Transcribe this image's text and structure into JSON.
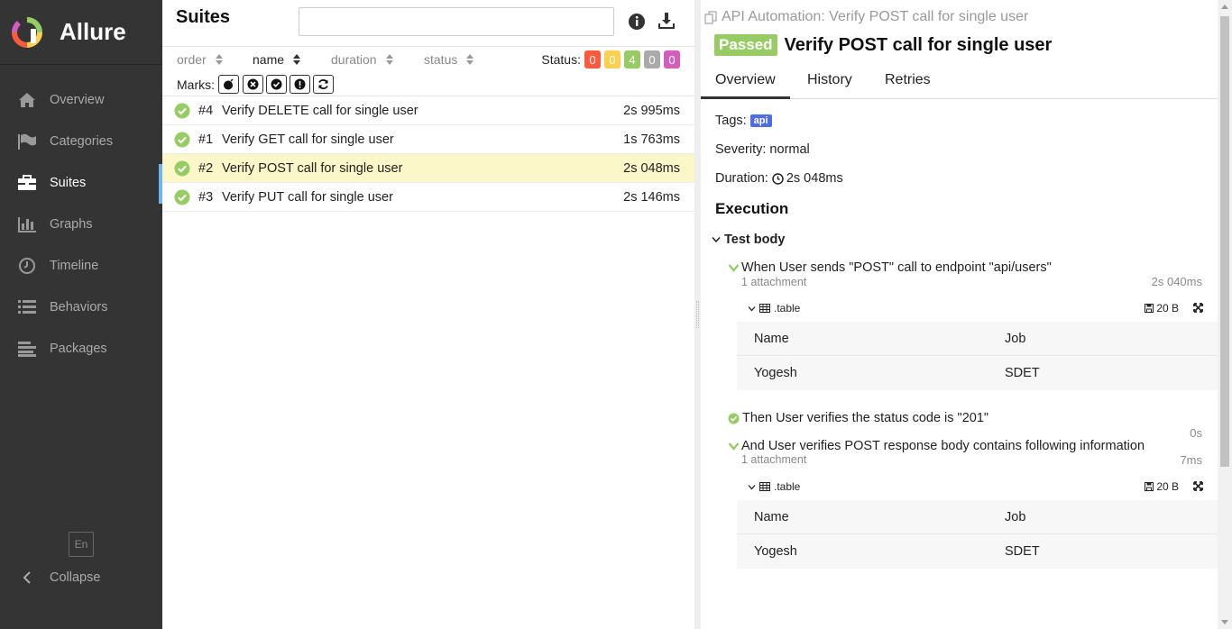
{
  "sidebar": {
    "brand": "Allure",
    "items": [
      {
        "label": "Overview",
        "icon": "home-icon"
      },
      {
        "label": "Categories",
        "icon": "flag-icon"
      },
      {
        "label": "Suites",
        "icon": "briefcase-icon",
        "active": true
      },
      {
        "label": "Graphs",
        "icon": "bar-chart-icon"
      },
      {
        "label": "Timeline",
        "icon": "clock-icon"
      },
      {
        "label": "Behaviors",
        "icon": "list-icon"
      },
      {
        "label": "Packages",
        "icon": "align-left-icon"
      }
    ],
    "language": "En",
    "collapse_label": "Collapse"
  },
  "suites": {
    "title": "Suites",
    "search": {
      "value": "",
      "placeholder": ""
    },
    "sort": {
      "order": "order",
      "name": "name",
      "duration": "duration",
      "status": "status"
    },
    "status_label": "Status:",
    "status_counts": [
      {
        "value": "0",
        "color": "#fd5a3e"
      },
      {
        "value": "0",
        "color": "#ffd050"
      },
      {
        "value": "4",
        "color": "#97cc64"
      },
      {
        "value": "0",
        "color": "#aaaaaa"
      },
      {
        "value": "0",
        "color": "#d35ebe"
      }
    ],
    "marks_label": "Marks:",
    "tests": [
      {
        "num": "#4",
        "name": "Verify DELETE call for single user",
        "duration": "2s 995ms"
      },
      {
        "num": "#1",
        "name": "Verify GET call for single user",
        "duration": "1s 763ms"
      },
      {
        "num": "#2",
        "name": "Verify POST call for single user",
        "duration": "2s 048ms",
        "selected": true
      },
      {
        "num": "#3",
        "name": "Verify PUT call for single user",
        "duration": "2s 146ms"
      }
    ]
  },
  "detail": {
    "breadcrumb": "API Automation: Verify POST call for single user",
    "status": "Passed",
    "title": "Verify POST call for single user",
    "tabs": [
      "Overview",
      "History",
      "Retries"
    ],
    "tags_label": "Tags:",
    "tag": "api",
    "severity": "Severity: normal",
    "duration_label": "Duration:",
    "duration": "2s 048ms",
    "execution": "Execution",
    "test_body": "Test body",
    "steps": [
      {
        "text": "When User sends \"POST\" call to endpoint \"api/users\"",
        "sub": "1 attachment",
        "duration": "2s 040ms",
        "attachment": ".table",
        "size": "20 B",
        "table": [
          [
            "Name",
            "Job"
          ],
          [
            "Yogesh",
            "SDET"
          ]
        ]
      },
      {
        "text": "Then User verifies the status code is \"201\"",
        "duration": "0s"
      },
      {
        "text": "And User verifies POST response body contains following information",
        "sub": "1 attachment",
        "duration": "7ms",
        "attachment": ".table",
        "size": "20 B",
        "table": [
          [
            "Name",
            "Job"
          ],
          [
            "Yogesh",
            "SDET"
          ]
        ]
      }
    ]
  },
  "colors": {
    "sidebar_bg": "#343434",
    "passed": "#97cc64",
    "selected_row": "#fcf7c8",
    "tag": "#4d6ce6"
  }
}
